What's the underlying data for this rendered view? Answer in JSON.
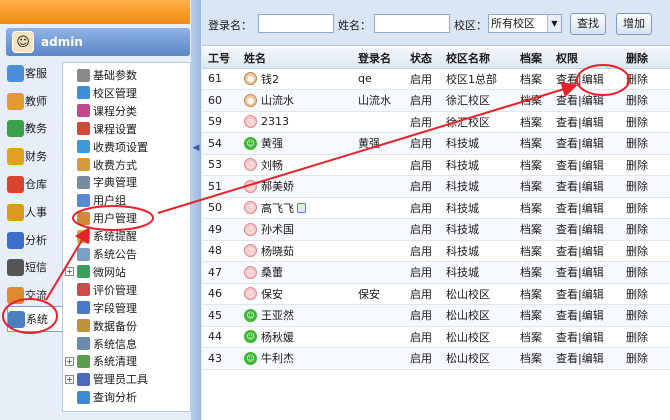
{
  "user": {
    "name": "admin"
  },
  "categories": [
    {
      "label": "客服",
      "icon": "headset-icon",
      "color": "#4a90d9"
    },
    {
      "label": "教师",
      "icon": "teacher-icon",
      "color": "#e39a35"
    },
    {
      "label": "教务",
      "icon": "books-icon",
      "color": "#3aa04a"
    },
    {
      "label": "财务",
      "icon": "money-icon",
      "color": "#e0a020"
    },
    {
      "label": "仓库",
      "icon": "house-icon",
      "color": "#d9442f"
    },
    {
      "label": "人事",
      "icon": "question-icon",
      "color": "#d99a20"
    },
    {
      "label": "分析",
      "icon": "bar-chart-icon",
      "color": "#3b6fc9"
    },
    {
      "label": "短信",
      "icon": "phone-icon",
      "color": "#555555"
    },
    {
      "label": "交流",
      "icon": "chat-icon",
      "color": "#e08a30"
    },
    {
      "label": "系统",
      "icon": "system-icon",
      "color": "#4a7fc0"
    }
  ],
  "tree": [
    {
      "label": "基础参数",
      "icon": "gear-icon",
      "color": "#8a8a8a",
      "expander": false
    },
    {
      "label": "校区管理",
      "icon": "globe-icon",
      "color": "#3a8fd6",
      "expander": false
    },
    {
      "label": "课程分类",
      "icon": "books-icon",
      "color": "#c24a8a",
      "expander": false
    },
    {
      "label": "课程设置",
      "icon": "book-icon",
      "color": "#d14a3a",
      "expander": false
    },
    {
      "label": "收费项设置",
      "icon": "coin-icon",
      "color": "#3a9ad6",
      "expander": false
    },
    {
      "label": "收费方式",
      "icon": "cash-icon",
      "color": "#d69a3a",
      "expander": false
    },
    {
      "label": "字典管理",
      "icon": "document-icon",
      "color": "#7a8aa0",
      "expander": false
    },
    {
      "label": "用户组",
      "icon": "users-icon",
      "color": "#5a8ad0",
      "expander": false
    },
    {
      "label": "用户管理",
      "icon": "user-icon",
      "color": "#d08a3a",
      "expander": false
    },
    {
      "label": "系统提醒",
      "icon": "bell-icon",
      "color": "#d0b03a",
      "expander": false
    },
    {
      "label": "系统公告",
      "icon": "notice-icon",
      "color": "#7aa0c8",
      "expander": false
    },
    {
      "label": "微网站",
      "icon": "web-icon",
      "color": "#3aa05a",
      "expander": true
    },
    {
      "label": "评价管理",
      "icon": "rating-icon",
      "color": "#d04a4a",
      "expander": false
    },
    {
      "label": "字段管理",
      "icon": "field-icon",
      "color": "#4a7ad0",
      "expander": false
    },
    {
      "label": "数据备份",
      "icon": "database-icon",
      "color": "#c0903a",
      "expander": false
    },
    {
      "label": "系统信息",
      "icon": "info-icon",
      "color": "#6a8ab0",
      "expander": false
    },
    {
      "label": "系统清理",
      "icon": "broom-icon",
      "color": "#5aa04a",
      "expander": true
    },
    {
      "label": "管理员工具",
      "icon": "tools-icon",
      "color": "#4a6ac0",
      "expander": true
    },
    {
      "label": "查询分析",
      "icon": "search-icon",
      "color": "#3a8ad6",
      "expander": false
    }
  ],
  "search": {
    "login_label": "登录名：",
    "name_label": "姓名：",
    "campus_label": "校区：",
    "campus_value": "所有校区",
    "find_button": "查找",
    "add_button": "增加"
  },
  "table": {
    "headers": [
      "工号",
      "姓名",
      "登录名",
      "状态",
      "校区名称",
      "档案",
      "权限",
      "删除"
    ],
    "view_label": "查看",
    "edit_label": "编辑",
    "sep": "|",
    "rows": [
      {
        "id": "61",
        "name": "钱2",
        "face": "person",
        "login": "qe",
        "status": "启用",
        "campus": "校区1总部",
        "file": "档案",
        "del": "删除"
      },
      {
        "id": "60",
        "name": "山流水",
        "face": "person",
        "login": "山流水",
        "status": "启用",
        "campus": "徐汇校区",
        "file": "档案",
        "del": "删除"
      },
      {
        "id": "59",
        "name": "2313",
        "face": "clock",
        "login": "",
        "status": "启用",
        "campus": "徐汇校区",
        "file": "档案",
        "del": "删除"
      },
      {
        "id": "54",
        "name": "黄强",
        "face": "smile",
        "login": "黄强",
        "status": "启用",
        "campus": "科技城",
        "file": "档案",
        "del": "删除"
      },
      {
        "id": "53",
        "name": "刘畅",
        "face": "clock",
        "login": "",
        "status": "启用",
        "campus": "科技城",
        "file": "档案",
        "del": "删除"
      },
      {
        "id": "51",
        "name": "郝美娇",
        "face": "clock",
        "login": "",
        "status": "启用",
        "campus": "科技城",
        "file": "档案",
        "del": "删除"
      },
      {
        "id": "50",
        "name": "高飞飞",
        "face": "clock",
        "login": "",
        "status": "启用",
        "campus": "科技城",
        "file": "档案",
        "del": "删除"
      },
      {
        "id": "49",
        "name": "孙术国",
        "face": "clock",
        "login": "",
        "status": "启用",
        "campus": "科技城",
        "file": "档案",
        "del": "删除"
      },
      {
        "id": "48",
        "name": "杨晓茹",
        "face": "clock",
        "login": "",
        "status": "启用",
        "campus": "科技城",
        "file": "档案",
        "del": "删除"
      },
      {
        "id": "47",
        "name": "桑蕾",
        "face": "clock",
        "login": "",
        "status": "启用",
        "campus": "科技城",
        "file": "档案",
        "del": "删除"
      },
      {
        "id": "46",
        "name": "保安",
        "face": "clock",
        "login": "保安",
        "status": "启用",
        "campus": "松山校区",
        "file": "档案",
        "del": "删除"
      },
      {
        "id": "45",
        "name": "王亚然",
        "face": "smile",
        "login": "",
        "status": "启用",
        "campus": "松山校区",
        "file": "档案",
        "del": "删除"
      },
      {
        "id": "44",
        "name": "杨秋媛",
        "face": "smile",
        "login": "",
        "status": "启用",
        "campus": "松山校区",
        "file": "档案",
        "del": "删除"
      },
      {
        "id": "43",
        "name": "牛利杰",
        "face": "smile",
        "login": "",
        "status": "启用",
        "campus": "松山校区",
        "file": "档案",
        "del": "删除"
      }
    ]
  },
  "colors": {
    "annotation": "#e8222a",
    "accent": "#5b86c6",
    "top_bar": "#f08a10"
  }
}
